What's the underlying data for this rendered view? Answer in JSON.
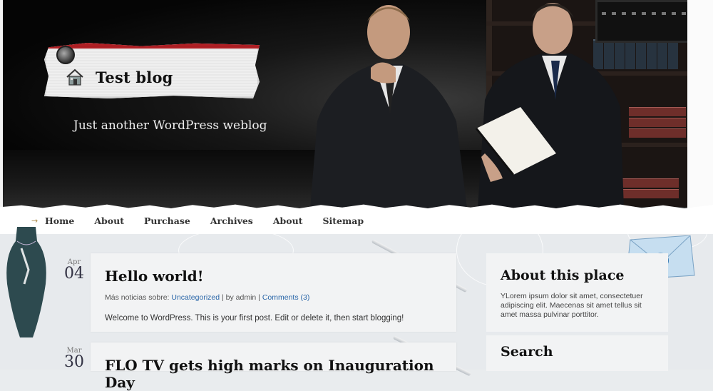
{
  "header": {
    "site_title": "Test blog",
    "tagline": "Just another WordPress weblog"
  },
  "nav": {
    "items": [
      "Home",
      "About",
      "Purchase",
      "Archives",
      "About",
      "Sitemap"
    ]
  },
  "posts": [
    {
      "month": "Apr",
      "day": "04",
      "title": "Hello world!",
      "meta_prefix": "Más noticias sobre: ",
      "category": "Uncategorized",
      "by": " | by admin | ",
      "comments": "Comments (3)",
      "body": "Welcome to WordPress. This is your first post. Edit or delete it, then start blogging!"
    },
    {
      "month": "Mar",
      "day": "30",
      "title": "FLO TV gets high marks on Inauguration Day"
    }
  ],
  "sidebar": {
    "about_title": "About this place",
    "about_text": "YLorem ipsum dolor sit amet, consectetuer adipiscing elit. Maecenas sit amet tellus sit amet massa pulvinar porttitor.",
    "search_title": "Search"
  },
  "icons": {
    "home": "house-icon",
    "pin": "pin-icon",
    "nav_arrow": "arrow-right-icon",
    "envelope": "email-envelope-icon"
  },
  "colors": {
    "accent_red": "#b01f24",
    "link_blue": "#2a66a8"
  }
}
